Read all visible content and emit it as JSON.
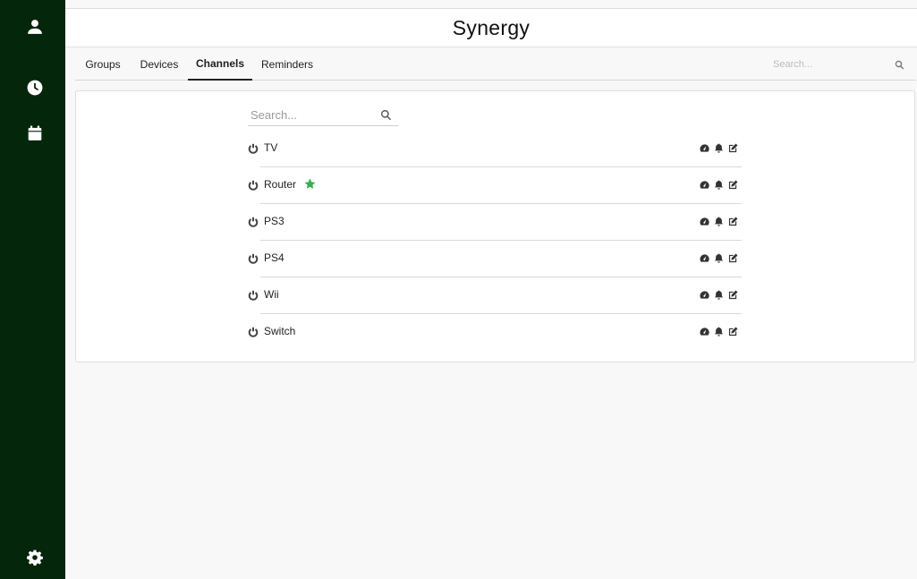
{
  "app": {
    "title": "Synergy"
  },
  "sidebar": {
    "icons": [
      {
        "name": "user-icon"
      },
      {
        "name": "clock-icon"
      },
      {
        "name": "calendar-icon"
      },
      {
        "name": "gear-icon"
      }
    ]
  },
  "tabs": [
    {
      "label": "Groups"
    },
    {
      "label": "Devices"
    },
    {
      "label": "Channels",
      "active": true
    },
    {
      "label": "Reminders"
    }
  ],
  "top_search": {
    "placeholder": "Search..."
  },
  "list_search": {
    "placeholder": "Search..."
  },
  "channels": [
    {
      "name": "TV",
      "favorite": false
    },
    {
      "name": "Router",
      "favorite": true
    },
    {
      "name": "PS3",
      "favorite": false
    },
    {
      "name": "PS4",
      "favorite": false
    },
    {
      "name": "Wii",
      "favorite": false
    },
    {
      "name": "Switch",
      "favorite": false
    }
  ],
  "colors": {
    "sidebar": "#04260a",
    "favorite_star": "#2fb34a"
  }
}
